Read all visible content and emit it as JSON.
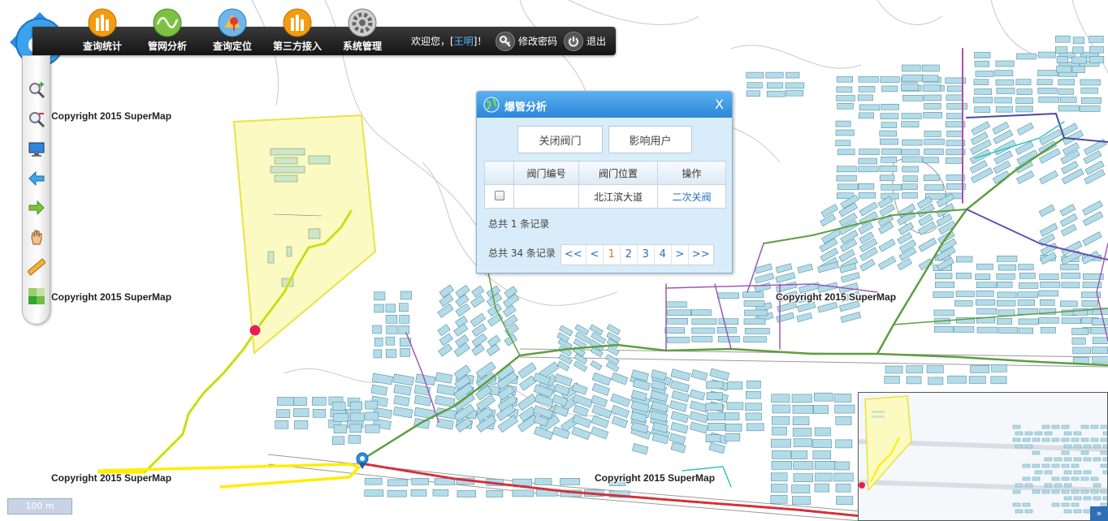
{
  "nav": {
    "items": [
      {
        "label": "查询统计",
        "icon": "bar-chart-icon"
      },
      {
        "label": "管网分析",
        "icon": "wave-chart-icon"
      },
      {
        "label": "查询定位",
        "icon": "map-pin-icon"
      },
      {
        "label": "第三方接入",
        "icon": "bar-chart-icon"
      },
      {
        "label": "系统管理",
        "icon": "gear-icon"
      }
    ],
    "welcome_prefix": "欢迎您，[",
    "user_name": "王明",
    "welcome_suffix": "]！",
    "change_password": "修改密码",
    "logout": "退出"
  },
  "tools": [
    "zoom-in-icon",
    "zoom-out-icon",
    "full-extent-icon",
    "back-arrow-icon",
    "forward-arrow-icon",
    "pan-hand-icon",
    "measure-ruler-icon",
    "layers-icon"
  ],
  "copyright": "Copyright 2015 SuperMap",
  "dialog": {
    "title": "爆管分析",
    "close": "X",
    "close_valve_button": "关闭阀门",
    "affected_users_button": "影响用户",
    "columns": [
      "",
      "阀门编号",
      "阀门位置",
      "操作"
    ],
    "rows": [
      {
        "checked": false,
        "valve_no": "",
        "location": "北江滨大道",
        "action": "二次关阀"
      }
    ],
    "record_total": "总共 1 条记录",
    "page_total": "总共 34 条记录",
    "pager": [
      "<<",
      "<",
      "1",
      "2",
      "3",
      "4",
      ">",
      ">>"
    ],
    "current_page": "1"
  },
  "scale_label": "100 m",
  "overview_toggle": "»",
  "colors": {
    "building_fill": "#b3dce8",
    "building_stroke": "#5a8fa3",
    "main_pipe": "#5e9e3e",
    "branch_pipe": "#9b59b6",
    "burst_pipe": "#ffee00",
    "road_pipe": "#d4303a",
    "alert_zone": "#fbfac0",
    "alert_zone_stroke": "#e9e23b",
    "dialog_header": "#2c86d8"
  }
}
